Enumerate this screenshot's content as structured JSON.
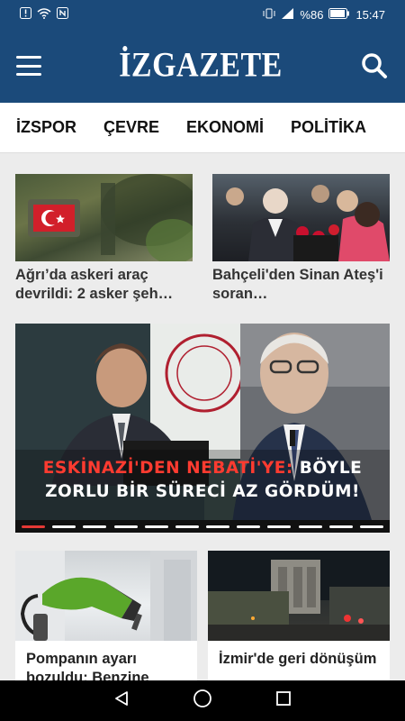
{
  "status": {
    "battery_percent": "%86",
    "time": "15:47"
  },
  "header": {
    "logo": "İZGAZETE",
    "menu_icon": "hamburger-menu-icon",
    "search_icon": "search-icon"
  },
  "tabs": [
    {
      "label": "İZSPOR"
    },
    {
      "label": "ÇEVRE"
    },
    {
      "label": "EKONOMİ"
    },
    {
      "label": "POLİTİKA"
    }
  ],
  "top_cards": [
    {
      "title": "Ağrı’da askeri araç devrildi: 2 asker şeh…"
    },
    {
      "title": "Bahçeli'den Sinan Ateş'i soran…"
    }
  ],
  "slider": {
    "headline_line1_a": "ESKİNAZİ'DEN NEBATİ'YE:",
    "headline_line1_b": "BÖYLE",
    "headline_line2": "ZORLU BİR SÜRECİ AZ GÖRDÜM!",
    "slide_count": 12,
    "active_slide": 1,
    "accent_color": "#ff3b30"
  },
  "bottom_cards": [
    {
      "title": "Pompanın ayarı bozuldu: Benzine"
    },
    {
      "title": "İzmir'de geri dönüşüm"
    }
  ],
  "nav": {
    "back_icon": "back-triangle-icon",
    "home_icon": "home-circle-icon",
    "recents_icon": "recents-square-icon"
  }
}
